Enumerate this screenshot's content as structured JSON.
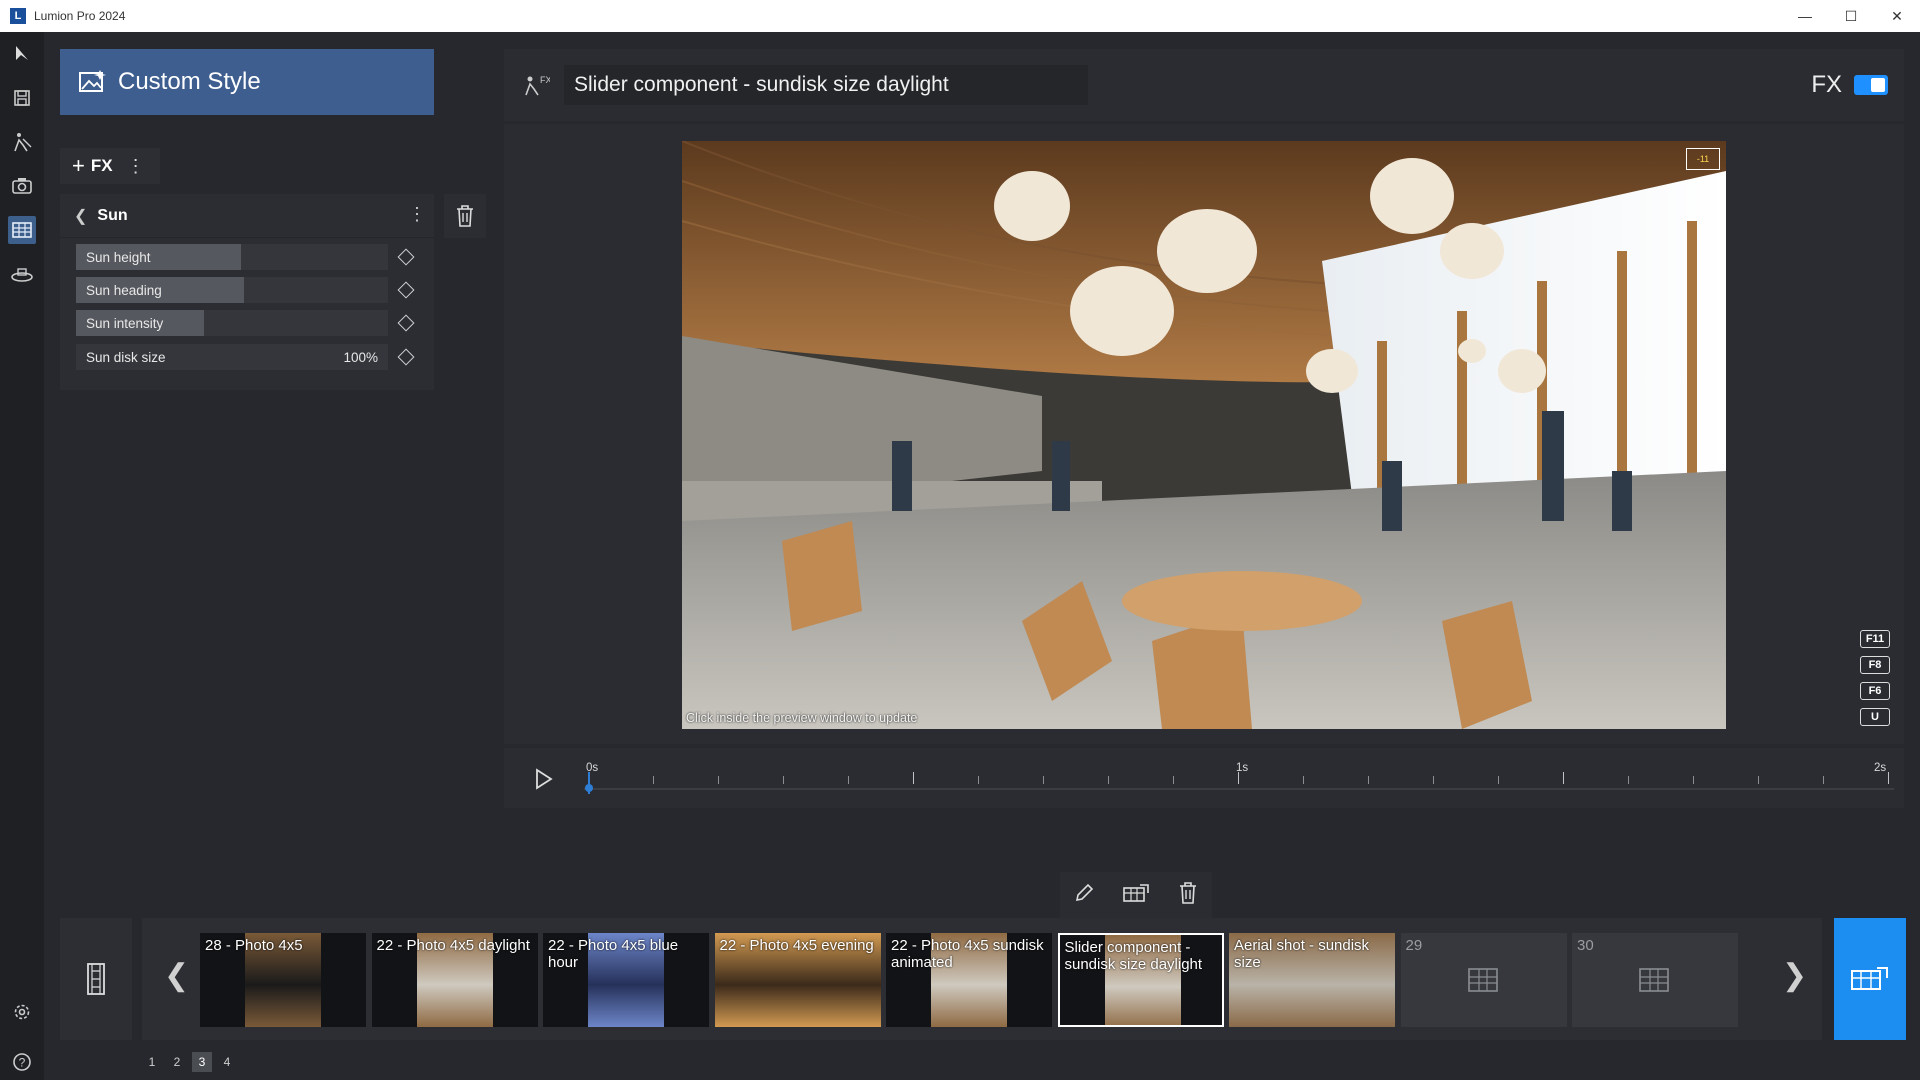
{
  "window": {
    "title": "Lumion Pro 2024",
    "logo_glyph": "L",
    "controls": [
      "minimize-icon",
      "maximize-icon",
      "close-icon"
    ]
  },
  "left_strip": {
    "icons": [
      "cursor-icon",
      "save-icon",
      "build-mode-icon",
      "photo-mode-icon",
      "movie-mode-icon",
      "360-panorama-icon"
    ],
    "active_index": 4,
    "bottom_icons": [
      "settings-icon",
      "help-icon"
    ]
  },
  "style_header": {
    "title": "Custom Style",
    "icon": "custom-style-icon"
  },
  "fx_toolbar": {
    "add_label": "FX"
  },
  "sun_panel": {
    "title": "Sun",
    "sliders": [
      {
        "label": "Sun height",
        "value": "",
        "fill": 0.53
      },
      {
        "label": "Sun heading",
        "value": "",
        "fill": 0.54
      },
      {
        "label": "Sun intensity",
        "value": "",
        "fill": 0.41
      },
      {
        "label": "Sun disk size",
        "value": "100%",
        "fill": 0.0
      }
    ]
  },
  "preview": {
    "clip_name": "Slider component - sundisk size daylight",
    "fx_label": "FX",
    "fx_enabled": true,
    "hint": "Click inside the preview window to update",
    "badge": "-11",
    "function_keys": [
      "F11",
      "F8",
      "F6",
      "U"
    ]
  },
  "timeline": {
    "labels": [
      "0s",
      "1s",
      "2s"
    ],
    "position": 0.0
  },
  "clip_tools": [
    "edit-icon",
    "export-clip-icon",
    "delete-clip-icon"
  ],
  "film_strip": {
    "clips": [
      {
        "label": "28 - Photo 4x5",
        "scene": "night",
        "selected": false,
        "empty": false
      },
      {
        "label": "22 - Photo 4x5 daylight",
        "scene": "day",
        "selected": false,
        "empty": false
      },
      {
        "label": "22 - Photo 4x5 blue hour",
        "scene": "blue",
        "selected": false,
        "empty": false
      },
      {
        "label": "22 - Photo 4x5 evening",
        "scene": "evening",
        "selected": false,
        "empty": false
      },
      {
        "label": "22 - Photo 4x5 sundisk animated",
        "scene": "day",
        "selected": false,
        "empty": false
      },
      {
        "label": "Slider component - sundisk size daylight",
        "scene": "day",
        "selected": true,
        "empty": false
      },
      {
        "label": "Aerial shot - sundisk size",
        "scene": "aerial",
        "selected": false,
        "empty": false
      },
      {
        "label": "29",
        "scene": "",
        "selected": false,
        "empty": true
      },
      {
        "label": "30",
        "scene": "",
        "selected": false,
        "empty": true
      }
    ]
  },
  "pagination": {
    "pages": [
      "1",
      "2",
      "3",
      "4"
    ],
    "active": "3"
  },
  "colors": {
    "accent": "#1c8ef2",
    "header": "#3d5e8e",
    "panel": "#2b2d32",
    "background": "#26282d"
  }
}
